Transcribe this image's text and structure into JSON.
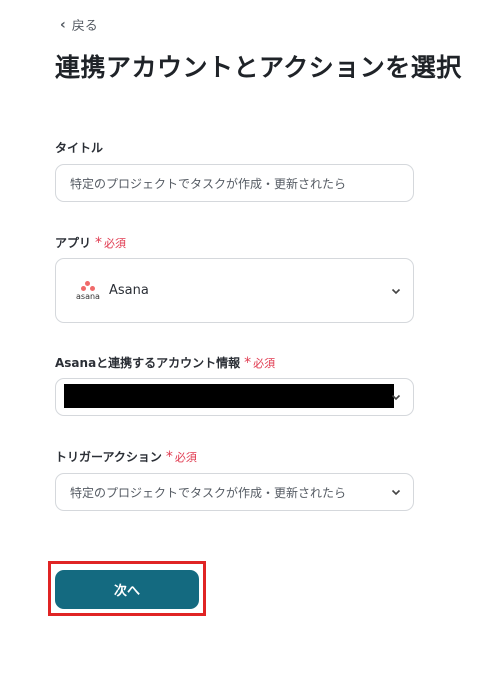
{
  "nav": {
    "back_label": "戻る"
  },
  "page": {
    "title": "連携アカウントとアクションを選択"
  },
  "form": {
    "title_field": {
      "label": "タイトル",
      "value": "特定のプロジェクトでタスクが作成・更新されたら"
    },
    "app_field": {
      "label": "アプリ",
      "required_label": "必須",
      "value": "Asana",
      "logo_text": "asana"
    },
    "account_field": {
      "label": "Asanaと連携するアカウント情報",
      "required_label": "必須"
    },
    "trigger_field": {
      "label": "トリガーアクション",
      "required_label": "必須",
      "value": "特定のプロジェクトでタスクが作成・更新されたら"
    }
  },
  "actions": {
    "next_label": "次へ"
  },
  "colors": {
    "accent": "#146a80",
    "required": "#e0394f",
    "highlight": "#e02424",
    "asana_logo": "#f06a6a"
  }
}
